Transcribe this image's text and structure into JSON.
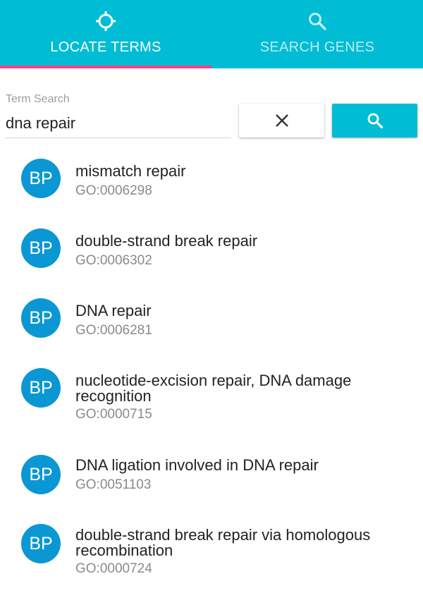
{
  "tabs": [
    {
      "label": "LOCATE TERMS",
      "icon": "crosshair-icon",
      "active": true
    },
    {
      "label": "SEARCH GENES",
      "icon": "search-icon",
      "active": false
    }
  ],
  "term_search": {
    "label": "Term Search",
    "value": "dna repair",
    "clear_icon": "close-icon",
    "search_icon": "search-icon"
  },
  "results": [
    {
      "badge": "BP",
      "name": "mismatch repair",
      "id": "GO:0006298"
    },
    {
      "badge": "BP",
      "name": "double-strand break repair",
      "id": "GO:0006302"
    },
    {
      "badge": "BP",
      "name": "DNA repair",
      "id": "GO:0006281"
    },
    {
      "badge": "BP",
      "name": "nucleotide-excision repair, DNA damage recognition",
      "id": "GO:0000715"
    },
    {
      "badge": "BP",
      "name": "DNA ligation involved in DNA repair",
      "id": "GO:0051103"
    },
    {
      "badge": "BP",
      "name": "double-strand break repair via homologous recombination",
      "id": "GO:0000724"
    }
  ],
  "colors": {
    "accent": "#00bcd4",
    "tab_indicator": "#ff4081",
    "badge": "#0b97d3"
  }
}
